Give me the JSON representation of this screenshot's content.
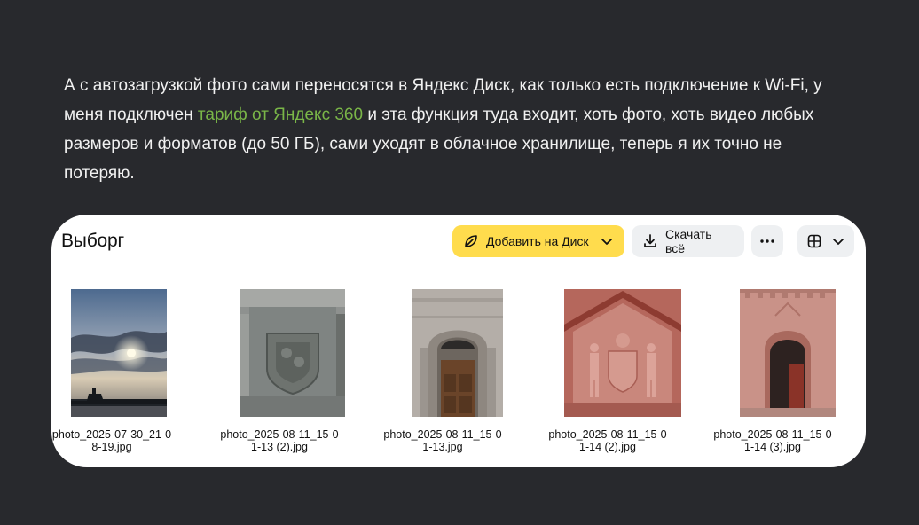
{
  "article": {
    "text_before_link": "А с автозагрузкой фото сами переносятся в Яндекс Диск, как только есть подключение к Wi-Fi, у меня подключен ",
    "link_text": "тариф от Яндекс 360",
    "text_after_link": " и эта функция туда входит, хоть фото, хоть видео любых размеров и форматов (до 50 ГБ), сами уходят в облачное хранилище, теперь я их точно не потеряю."
  },
  "folder": {
    "title": "Выборг",
    "toolbar": {
      "add_label": "Добавить на Диск",
      "add_icon": "leaf-icon",
      "download_label": "Скачать всё",
      "download_icon": "download-icon",
      "more_icon": "ellipsis-icon",
      "view_icon": "grid-icon"
    },
    "files": [
      {
        "name_line1": "photo_2025-07-30_21-0",
        "name_line2": "8-19.jpg",
        "subject": "sunset sky over castle silhouette"
      },
      {
        "name_line1": "photo_2025-08-11_15-0",
        "name_line2": "1-13 (2).jpg",
        "subject": "stone facade with coat of arms"
      },
      {
        "name_line1": "photo_2025-08-11_15-0",
        "name_line2": "1-13.jpg",
        "subject": "granite arched doorway"
      },
      {
        "name_line1": "photo_2025-08-11_15-0",
        "name_line2": "1-14 (2).jpg",
        "subject": "red relief with two figures and shield"
      },
      {
        "name_line1": "photo_2025-08-11_15-0",
        "name_line2": "1-14 (3).jpg",
        "subject": "red stone arched entrance"
      }
    ]
  },
  "colors": {
    "background": "#28292d",
    "link": "#7ab648",
    "primary_button": "#ffdc4d",
    "secondary_button": "#eef0f2"
  }
}
